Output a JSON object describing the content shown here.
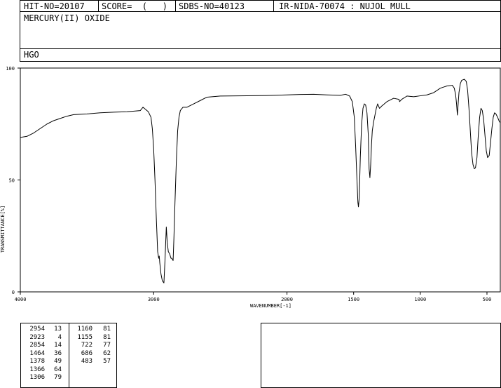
{
  "header": {
    "hit_no": "HIT-NO=20107",
    "score": "SCORE=  (   )",
    "sdbs_no": "SDBS-NO=40123",
    "ir_id": "IR-NIDA-70074 : NUJOL MULL",
    "compound_name": "MERCURY(II) OXIDE",
    "formula": "HGO"
  },
  "chart_data": {
    "type": "line",
    "title": "",
    "xlabel": "WAVENUMBER[-1]",
    "ylabel": "TRANSMITTANCE[%]",
    "xlim": [
      4000,
      400
    ],
    "ylim": [
      0,
      100
    ],
    "x_ticks": [
      4000,
      3000,
      2000,
      1500,
      1000,
      500
    ],
    "x_tick_labels": [
      "4000",
      "3000",
      "2000",
      "1500",
      "1000",
      "500"
    ],
    "y_ticks": [
      0,
      50,
      100
    ],
    "y_tick_labels": [
      "0",
      "50",
      "100"
    ],
    "grid": false,
    "series": [
      {
        "values_xy": [
          [
            4000,
            69
          ],
          [
            3950,
            69.5
          ],
          [
            3900,
            71
          ],
          [
            3850,
            73
          ],
          [
            3800,
            75
          ],
          [
            3750,
            76.5
          ],
          [
            3700,
            77.5
          ],
          [
            3650,
            78.5
          ],
          [
            3600,
            79.2
          ],
          [
            3500,
            79.5
          ],
          [
            3400,
            80
          ],
          [
            3300,
            80.3
          ],
          [
            3200,
            80.5
          ],
          [
            3100,
            81
          ],
          [
            3080,
            82.5
          ],
          [
            3060,
            81.5
          ],
          [
            3040,
            80.5
          ],
          [
            3020,
            78
          ],
          [
            3010,
            73
          ],
          [
            3000,
            64
          ],
          [
            2990,
            50
          ],
          [
            2980,
            33
          ],
          [
            2970,
            18
          ],
          [
            2962,
            15
          ],
          [
            2958,
            16
          ],
          [
            2954,
            13
          ],
          [
            2945,
            8
          ],
          [
            2935,
            5
          ],
          [
            2923,
            4
          ],
          [
            2915,
            14
          ],
          [
            2905,
            29
          ],
          [
            2898,
            22
          ],
          [
            2890,
            18
          ],
          [
            2880,
            17
          ],
          [
            2870,
            15
          ],
          [
            2864,
            15
          ],
          [
            2854,
            14
          ],
          [
            2848,
            24
          ],
          [
            2840,
            40
          ],
          [
            2830,
            58
          ],
          [
            2820,
            72
          ],
          [
            2810,
            78
          ],
          [
            2800,
            81
          ],
          [
            2780,
            82.5
          ],
          [
            2750,
            82.5
          ],
          [
            2700,
            84
          ],
          [
            2650,
            85.5
          ],
          [
            2600,
            87
          ],
          [
            2500,
            87.5
          ],
          [
            2300,
            87.6
          ],
          [
            2100,
            87.8
          ],
          [
            2000,
            88
          ],
          [
            1900,
            88.2
          ],
          [
            1800,
            88.3
          ],
          [
            1700,
            88
          ],
          [
            1600,
            87.8
          ],
          [
            1560,
            88.3
          ],
          [
            1530,
            87.5
          ],
          [
            1510,
            85
          ],
          [
            1495,
            78
          ],
          [
            1485,
            65
          ],
          [
            1475,
            50
          ],
          [
            1468,
            40
          ],
          [
            1464,
            38
          ],
          [
            1458,
            42
          ],
          [
            1450,
            60
          ],
          [
            1440,
            75
          ],
          [
            1430,
            82
          ],
          [
            1420,
            84
          ],
          [
            1410,
            83.5
          ],
          [
            1400,
            80
          ],
          [
            1390,
            70
          ],
          [
            1384,
            55
          ],
          [
            1378,
            51
          ],
          [
            1372,
            57
          ],
          [
            1366,
            66
          ],
          [
            1360,
            72
          ],
          [
            1350,
            76
          ],
          [
            1340,
            79
          ],
          [
            1330,
            82
          ],
          [
            1320,
            84
          ],
          [
            1306,
            82
          ],
          [
            1290,
            83
          ],
          [
            1250,
            85
          ],
          [
            1200,
            86.5
          ],
          [
            1160,
            86
          ],
          [
            1155,
            85
          ],
          [
            1140,
            86
          ],
          [
            1100,
            87.5
          ],
          [
            1050,
            87.2
          ],
          [
            1000,
            87.6
          ],
          [
            950,
            88
          ],
          [
            900,
            89
          ],
          [
            850,
            91
          ],
          [
            800,
            92
          ],
          [
            760,
            92.3
          ],
          [
            745,
            91
          ],
          [
            735,
            88
          ],
          [
            728,
            84
          ],
          [
            722,
            79
          ],
          [
            716,
            84
          ],
          [
            710,
            89
          ],
          [
            700,
            93
          ],
          [
            690,
            94.5
          ],
          [
            670,
            95
          ],
          [
            655,
            94
          ],
          [
            645,
            90
          ],
          [
            635,
            82
          ],
          [
            625,
            72
          ],
          [
            615,
            62
          ],
          [
            605,
            57
          ],
          [
            595,
            55
          ],
          [
            586,
            55.5
          ],
          [
            575,
            60
          ],
          [
            565,
            70
          ],
          [
            555,
            78
          ],
          [
            545,
            82
          ],
          [
            535,
            81
          ],
          [
            525,
            77
          ],
          [
            515,
            70
          ],
          [
            505,
            63
          ],
          [
            495,
            60
          ],
          [
            483,
            61
          ],
          [
            473,
            67
          ],
          [
            463,
            73
          ],
          [
            453,
            78
          ],
          [
            443,
            80
          ],
          [
            433,
            79.5
          ],
          [
            420,
            78
          ],
          [
            410,
            76.5
          ],
          [
            400,
            75.5
          ]
        ]
      }
    ]
  },
  "peak_table": {
    "columns": [
      [
        [
          "2954",
          "13"
        ],
        [
          "2923",
          "4"
        ],
        [
          "2854",
          "14"
        ],
        [
          "1464",
          "36"
        ],
        [
          "1378",
          "49"
        ],
        [
          "1366",
          "64"
        ],
        [
          "1306",
          "79"
        ]
      ],
      [
        [
          "1160",
          "81"
        ],
        [
          "1155",
          "81"
        ],
        [
          "722",
          "77"
        ],
        [
          "686",
          "62"
        ],
        [
          "483",
          "57"
        ]
      ]
    ]
  }
}
